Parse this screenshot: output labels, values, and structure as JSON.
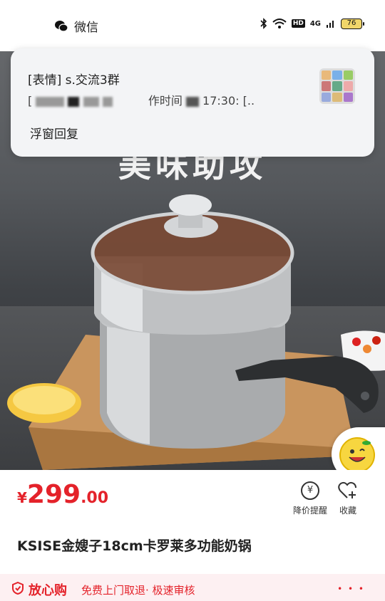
{
  "status_bar": {
    "app_name": "微信",
    "network": "4G",
    "hd_badge": "HD",
    "battery_level": "76"
  },
  "notification": {
    "title": "[表情] s.交流3群",
    "preview_prefix": "[",
    "preview_middle": "作时间",
    "preview_time": "17:30:",
    "preview_suffix": "[..",
    "reply_label": "浮窗回复"
  },
  "product": {
    "image_headline": "美味助攻",
    "price_currency": "¥",
    "price_integer": "299",
    "price_decimal": ".00",
    "title": "KSISE金嫂子18cm卡罗莱多功能奶锅"
  },
  "actions": {
    "price_alert_label": "降价提醒",
    "favorite_label": "收藏"
  },
  "assurance": {
    "label": "放心购",
    "description": "免费上门取退· 极速审核"
  },
  "colors": {
    "accent": "#e4222a",
    "assurance_bg": "#fdf0f2",
    "card_bg": "#f3f4f6"
  },
  "icons": {
    "wechat": "wechat-icon",
    "bluetooth": "bluetooth-icon",
    "wifi": "wifi-icon",
    "battery": "battery-icon",
    "price_alert": "yen-bell-icon",
    "favorite": "heart-plus-icon",
    "shield": "shield-icon",
    "float_emoji": "smiley-emoji-icon"
  }
}
